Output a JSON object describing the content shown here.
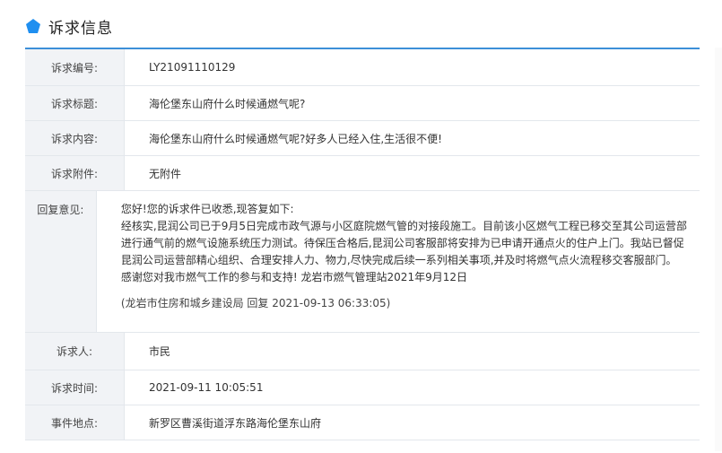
{
  "header": {
    "title": "诉求信息",
    "icon": "pentagon-icon",
    "accent_color": "#1f8ff0"
  },
  "fields": {
    "number": {
      "label": "诉求编号:",
      "value": "LY21091110129"
    },
    "title": {
      "label": "诉求标题:",
      "value": "海伦堡东山府什么时候通燃气呢?"
    },
    "content": {
      "label": "诉求内容:",
      "value": "海伦堡东山府什么时候通燃气呢?好多人已经入住,生活很不便!"
    },
    "attachment": {
      "label": "诉求附件:",
      "value": "无附件"
    },
    "reply": {
      "label": "回复意见:",
      "lines": [
        "您好!您的诉求件已收悉,现答复如下:",
        "经核实,昆润公司已于9月5日完成市政气源与小区庭院燃气管的对接段施工。目前该小区燃气工程已移交至其公司运营部",
        "进行通气前的燃气设施系统压力测试。待保压合格后,昆润公司客服部将安排为已申请开通点火的住户上门。我站已督促",
        "昆润公司运营部精心组织、合理安排人力、物力,尽快完成后续一系列相关事项,并及时将燃气点火流程移交客服部门。",
        "感谢您对我市燃气工作的参与和支持!    龙岩市燃气管理站2021年9月12日"
      ],
      "source": "(龙岩市住房和城乡建设局 回复 2021-09-13 06:33:05)"
    },
    "petitioner": {
      "label": "诉求人:",
      "value": "市民"
    },
    "time": {
      "label": "诉求时间:",
      "value": "2021-09-11 10:05:51"
    },
    "location": {
      "label": "事件地点:",
      "value": "新罗区曹溪街道浮东路海伦堡东山府"
    }
  }
}
